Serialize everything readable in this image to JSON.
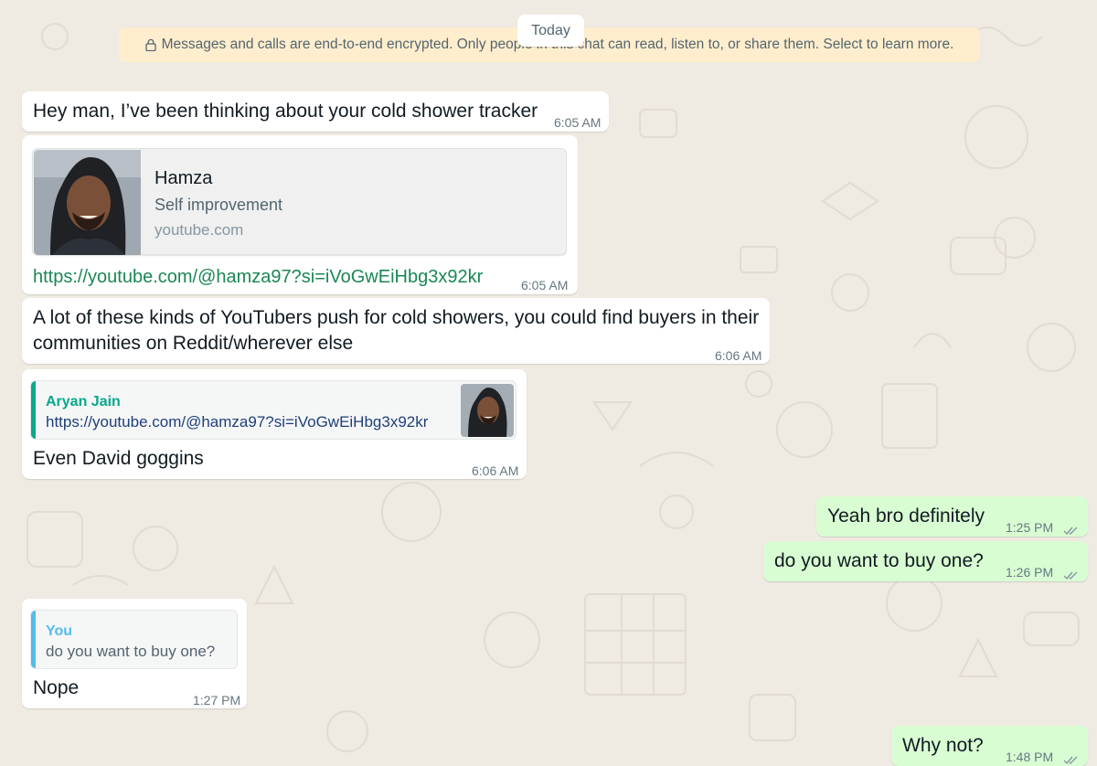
{
  "chat": {
    "date_chip": "Today",
    "encryption_notice": "Messages and calls are end-to-end encrypted. Only people in this chat can read, listen to, or share them. Select to learn more.",
    "messages": [
      {
        "text": "Hey man, I’ve been thinking about your cold shower tracker",
        "time": "6:05 AM"
      },
      {
        "link_preview": {
          "title": "Hamza",
          "description": "Self improvement",
          "domain": "youtube.com"
        },
        "text": "https://youtube.com/@hamza97?si=iVoGwEiHbg3x92kr",
        "time": "6:05 AM"
      },
      {
        "text_line1": "A lot of these kinds of YouTubers push for cold showers, you could find buyers in their",
        "text_line2": "communities on Reddit/wherever else",
        "time": "6:06 AM"
      },
      {
        "quote": {
          "author": "Aryan Jain",
          "body": "https://youtube.com/@hamza97?si=iVoGwEiHbg3x92kr"
        },
        "text": "Even David goggins",
        "time": "6:06 AM"
      },
      {
        "text": "Yeah bro definitely",
        "time": "1:25 PM"
      },
      {
        "text": "do you want to buy one?",
        "time": "1:26 PM"
      },
      {
        "quote": {
          "author": "You",
          "body": "do you want to buy one?"
        },
        "text": "Nope",
        "time": "1:27 PM"
      },
      {
        "text": "Why not?",
        "time": "1:48 PM"
      }
    ]
  },
  "colors": {
    "background": "#efeae2",
    "incoming_bubble": "#ffffff",
    "outgoing_bubble": "#d9fdd3",
    "notice_background": "#ffeecd",
    "read_ticks": "#8696a0",
    "quote_author_contact": "#06a98a",
    "quote_author_self": "#53bdeb",
    "link_text": "#1b8755"
  },
  "icons": {
    "lock": "lock-icon",
    "double_check": "double-check-icon",
    "preview_image": "profile-photo"
  }
}
